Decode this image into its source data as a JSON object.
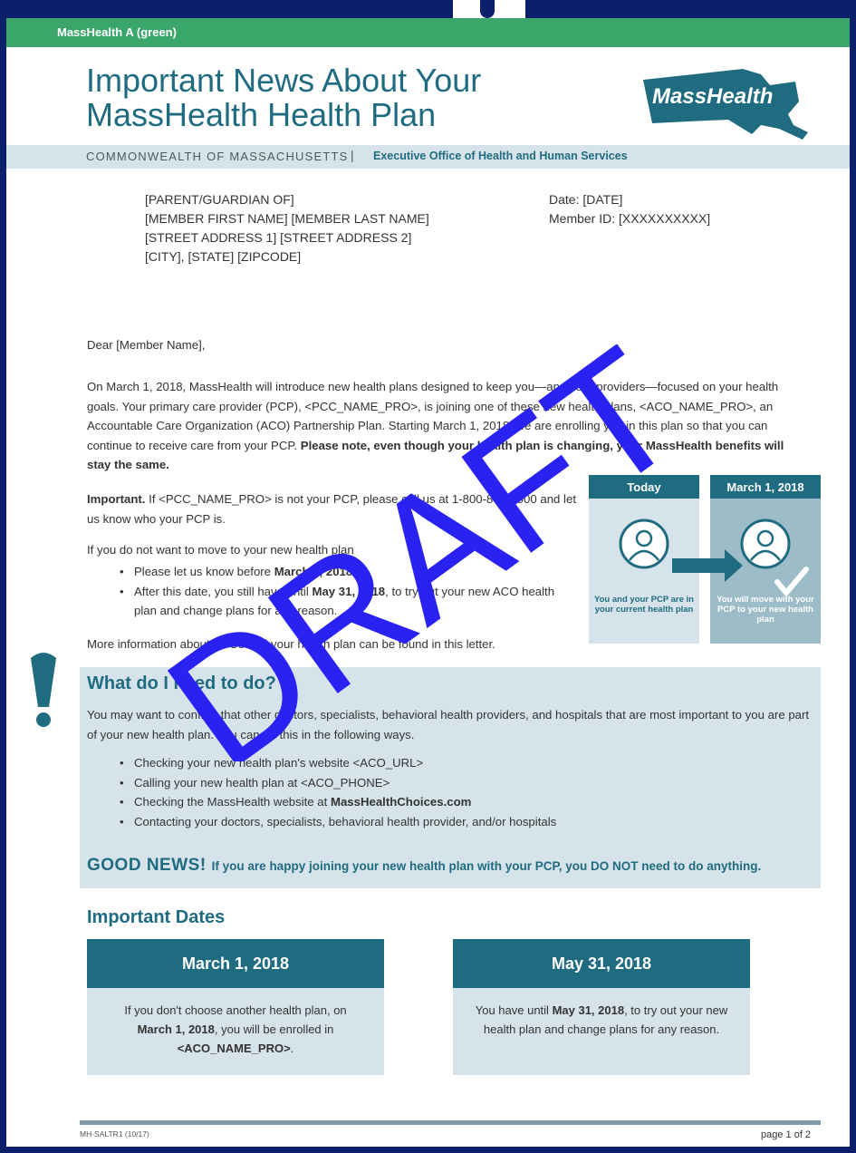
{
  "header": {
    "color_label": "MassHealth A (green)",
    "title_line1": "Important News About Your",
    "title_line2": "MassHealth Health Plan",
    "logo_text": "MassHealth",
    "gov_left": "COMMONWEALTH OF MASSACHUSETTS",
    "gov_sep": "|",
    "gov_right": "Executive Office of Health and Human Services"
  },
  "address": {
    "line1": "[PARENT/GUARDIAN OF]",
    "line2": "[MEMBER FIRST NAME] [MEMBER LAST NAME]",
    "line3": "[STREET ADDRESS 1] [STREET ADDRESS 2]",
    "line4": "[CITY], [STATE] [ZIPCODE]"
  },
  "meta": {
    "date": "Date: [DATE]",
    "member_id": "Member ID: [XXXXXXXXXX]"
  },
  "letter": {
    "greeting": "Dear [Member Name],",
    "intro_a": "On March 1, 2018, MassHealth will introduce new health plans designed to keep you—and your providers—focused on your health goals. Your primary care provider (PCP), <PCC_NAME_PRO>, is joining one of these new health plans, <ACO_NAME_PRO>, an Accountable Care Organization (ACO) Partnership Plan. Starting March 1, 2018, we are enrolling you in this plan so that you can continue to receive care from your PCP.",
    "intro_b": "Please note, even though your health plan is changing, your MassHealth benefits will stay the same.",
    "important_label": "Important.",
    "important_text": "If <PCC_NAME_PRO> is not your PCP, please call us at 1-800-841-2900 and let us know who your PCP is.",
    "not_move": "If you do not want to move to your new health plan",
    "bullet1_a": "Please let us know before",
    "bullet1_b": "March 1, 2018",
    "bullet1_c": ".",
    "bullet2_a": "After this date, you still have until",
    "bullet2_b": "May 31, 2018",
    "bullet2_c": ", to try out your new ACO health plan and change plans for any reason.",
    "more_info": "More information about ACOs and your health plan can be found in this letter."
  },
  "graphic": {
    "today_label": "Today",
    "march_label": "March 1, 2018",
    "today_caption": "You and your PCP are in your current health plan",
    "march_caption": "You will move with your PCP to your new health plan"
  },
  "need": {
    "heading": "What do I need to do?",
    "text": "You may want to confirm that other doctors, specialists, behavioral health providers, and hospitals that are most important to you are part of your new health plan. You can do this in the following ways.",
    "items": [
      "Checking your new health plan's website <ACO_URL>",
      "Calling your new health plan at <ACO_PHONE>",
      "Checking the MassHealth website at ",
      "Contacting your doctors, specialists, behavioral health provider, and/or hospitals"
    ],
    "website_bold": "MassHealthChoices.com",
    "good_big": "GOOD NEWS!",
    "good_text": "If you are happy joining your new health plan with your PCP, you DO NOT need to do anything."
  },
  "dates": {
    "heading": "Important Dates",
    "card1_title": "March 1, 2018",
    "card1_a": "If you don't choose another health plan, on",
    "card1_b": "March 1, 2018",
    "card1_c": ", you will be enrolled in",
    "card1_d": "<ACO_NAME_PRO>",
    "card1_e": ".",
    "card2_title": "May 31, 2018",
    "card2_a": "You have until",
    "card2_b": "May 31, 2018",
    "card2_c": ", to try out your new health plan and change plans for any reason."
  },
  "footer": {
    "code": "MH-SALTR1 (10/17)",
    "page": "page 1 of 2"
  },
  "watermark": "DRAFT",
  "colors": {
    "teal": "#1f6b80",
    "green": "#3aa66a",
    "light_blue": "#d7e3ea",
    "watermark": "#2a22f3"
  }
}
